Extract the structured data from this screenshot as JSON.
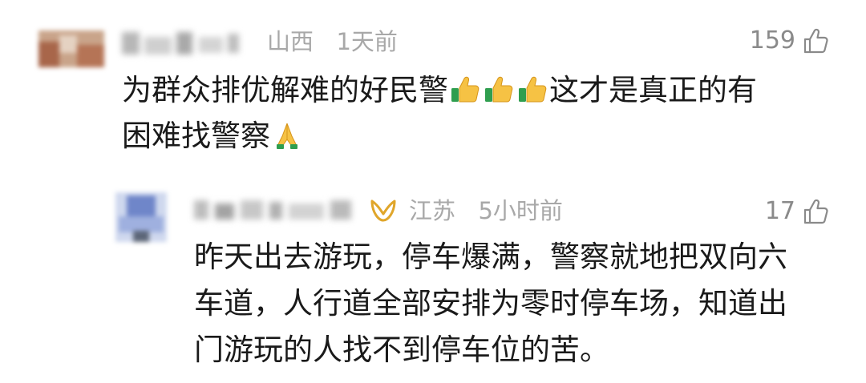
{
  "comments": [
    {
      "location": "山西",
      "time": "1天前",
      "likes": "159",
      "text_lines": [
        "为群众排优解难的好民警",
        "这才是真正的有",
        "困难找警察"
      ],
      "emojis": [
        "thumbs-up",
        "thumbs-up",
        "thumbs-up",
        "folded-hands"
      ]
    },
    {
      "location": "江苏",
      "time": "5小时前",
      "likes": "17",
      "badge_icon": "vip-badge-icon",
      "text_lines": [
        "昨天出去游玩，停车爆满，警察就地把双向六",
        "车道，人行道全部安排为零时停车场，知道出",
        "门游玩的人找不到停车位的苦。"
      ]
    }
  ]
}
